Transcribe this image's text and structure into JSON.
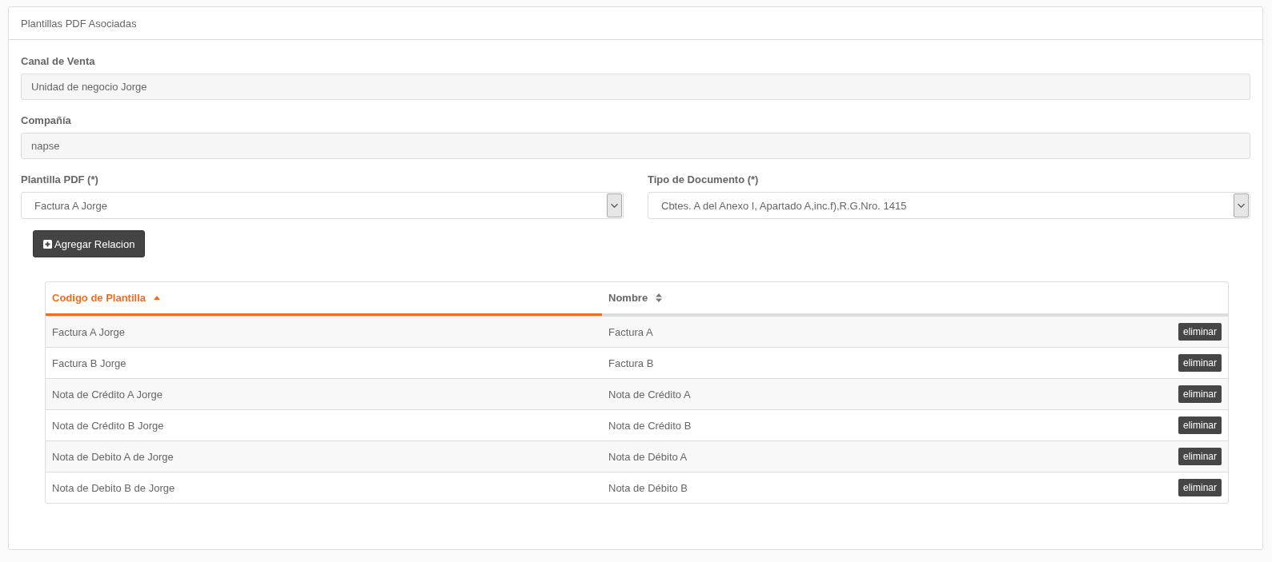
{
  "panel": {
    "title": "Plantillas PDF Asociadas"
  },
  "fields": [
    {
      "kind": "readonly",
      "label": "Canal de Venta",
      "value": "Unidad de negocio Jorge"
    },
    {
      "kind": "readonly",
      "label": "Compañía",
      "value": "napse"
    }
  ],
  "selects": [
    {
      "label": "Plantilla PDF (*)",
      "value": "Factura A Jorge"
    },
    {
      "label": "Tipo de Documento (*)",
      "value": "Cbtes. A del Anexo I, Apartado A,inc.f),R.G.Nro. 1415"
    }
  ],
  "add_button": {
    "label": "Agregar Relacion"
  },
  "table": {
    "columns": [
      {
        "label": "Codigo de Plantilla",
        "sorted": true
      },
      {
        "label": "Nombre",
        "sorted": false
      }
    ],
    "rows": [
      {
        "code": "Factura A Jorge",
        "name": "Factura A",
        "action": "eliminar"
      },
      {
        "code": "Factura B Jorge",
        "name": "Factura B",
        "action": "eliminar"
      },
      {
        "code": "Nota de Crédito A Jorge",
        "name": "Nota de Crédito A",
        "action": "eliminar"
      },
      {
        "code": "Nota de Crédito B Jorge",
        "name": "Nota de Crédito B",
        "action": "eliminar"
      },
      {
        "code": "Nota de Debito A de Jorge",
        "name": "Nota de Débito A",
        "action": "eliminar"
      },
      {
        "code": "Nota de Debito B de Jorge",
        "name": "Nota de Débito B",
        "action": "eliminar"
      }
    ]
  }
}
